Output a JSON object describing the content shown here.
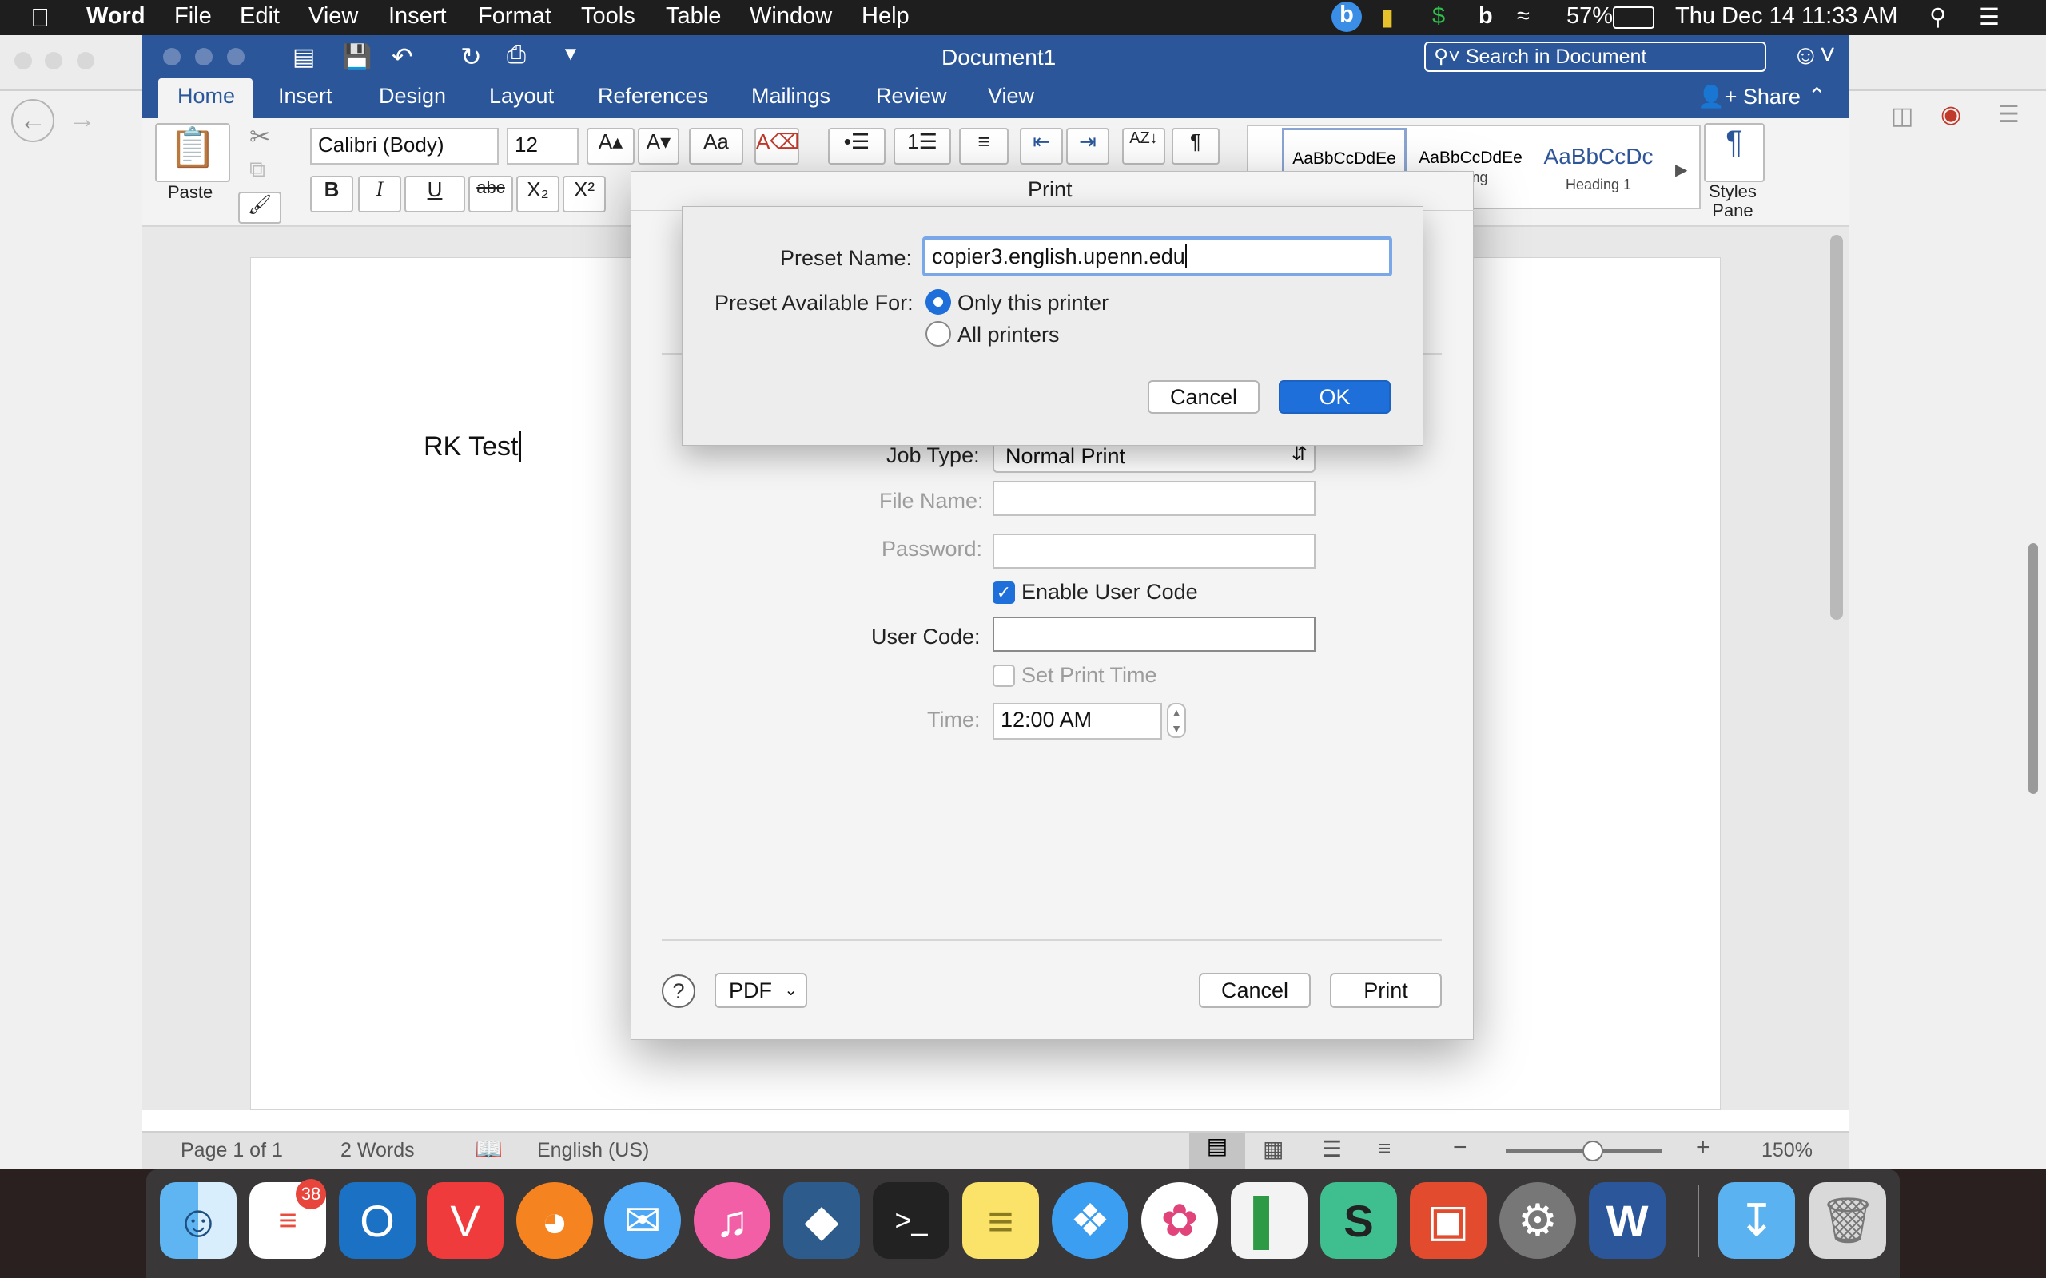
{
  "menubar": {
    "app_name": "Word",
    "menus": [
      "File",
      "Edit",
      "View",
      "Insert",
      "Format",
      "Tools",
      "Table",
      "Window",
      "Help"
    ],
    "battery": "57%",
    "datetime": "Thu Dec 14  11:33 AM"
  },
  "word": {
    "title": "Document1",
    "search_placeholder": "Search in Document",
    "tabs": [
      "Home",
      "Insert",
      "Design",
      "Layout",
      "References",
      "Mailings",
      "Review",
      "View"
    ],
    "share_label": "Share",
    "paste_label": "Paste",
    "font_name": "Calibri (Body)",
    "font_size": "12",
    "styles": [
      {
        "preview": "AaBbCcDdEe",
        "name": ""
      },
      {
        "preview": "AaBbCcDdEe",
        "name": "acing"
      },
      {
        "preview": "AaBbCcDc",
        "name": "Heading 1"
      }
    ],
    "styles_pane_label_1": "Styles",
    "styles_pane_label_2": "Pane",
    "doc_text": "RK Test",
    "status": {
      "page": "Page 1 of 1",
      "words": "2 Words",
      "language": "English (US)",
      "zoom": "150%"
    }
  },
  "print_dialog": {
    "title": "Print",
    "job_type_label": "Job Type:",
    "job_type_value": "Normal Print",
    "file_name_label": "File Name:",
    "password_label": "Password:",
    "enable_user_code_label": "Enable User Code",
    "user_code_label": "User Code:",
    "set_print_time_label": "Set Print Time",
    "time_label": "Time:",
    "time_value": "12:00 AM",
    "help_label": "?",
    "pdf_label": "PDF",
    "cancel_label": "Cancel",
    "print_label": "Print"
  },
  "preset_sheet": {
    "preset_name_label": "Preset Name:",
    "preset_name_value": "copier3.english.upenn.edu",
    "available_for_label": "Preset Available For:",
    "option_only": "Only this printer",
    "option_all": "All printers",
    "cancel_label": "Cancel",
    "ok_label": "OK"
  },
  "dock": {
    "reminders_badge": "38"
  },
  "colors": {
    "word_blue": "#2b579a",
    "accent_blue": "#1e6fd9"
  }
}
